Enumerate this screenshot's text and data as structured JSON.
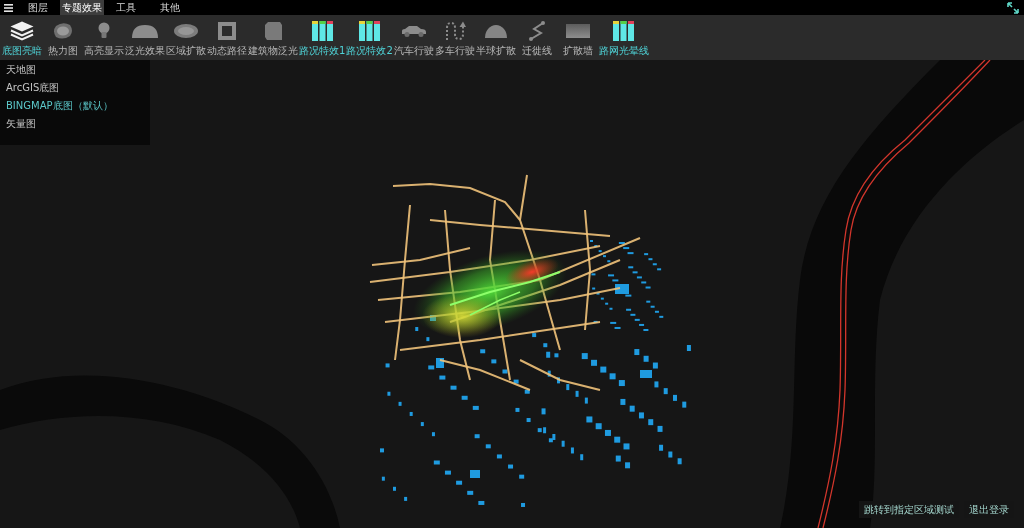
{
  "top_bar": {
    "tabs": [
      {
        "label": "图层",
        "selected": false
      },
      {
        "label": "专题效果",
        "selected": true
      },
      {
        "label": "工具",
        "selected": false
      },
      {
        "label": "其他",
        "selected": false
      }
    ]
  },
  "toolbar": {
    "items": [
      {
        "label": "底图亮暗",
        "kind": "layers",
        "active": true
      },
      {
        "label": "热力图",
        "kind": "blob",
        "active": false
      },
      {
        "label": "高亮显示",
        "kind": "bulb",
        "active": false
      },
      {
        "label": "泛光效果",
        "kind": "dome",
        "active": false
      },
      {
        "label": "区域扩散",
        "kind": "ellipse",
        "active": false
      },
      {
        "label": "动态路径",
        "kind": "frame",
        "active": false
      },
      {
        "label": "建筑物泛光",
        "kind": "cube",
        "active": false
      },
      {
        "label": "路况特效1",
        "kind": "bars",
        "active": true
      },
      {
        "label": "路况特效2",
        "kind": "bars",
        "active": true
      },
      {
        "label": "汽车行驶",
        "kind": "car",
        "active": false
      },
      {
        "label": "多车行驶",
        "kind": "multipath",
        "active": false
      },
      {
        "label": "半球扩散",
        "kind": "hemisphere",
        "active": false
      },
      {
        "label": "迁徙线",
        "kind": "zigzag",
        "active": false
      },
      {
        "label": "扩散墙",
        "kind": "wall",
        "active": false
      },
      {
        "label": "路网光晕线",
        "kind": "bars",
        "active": true
      }
    ]
  },
  "basemap_panel": {
    "items": [
      {
        "label": "天地图",
        "selected": false
      },
      {
        "label": "ArcGIS底图",
        "selected": false
      },
      {
        "label": "BINGMAP底图（默认）",
        "selected": true
      },
      {
        "label": "矢量图",
        "selected": false
      }
    ]
  },
  "map_actions": [
    "跳转到指定区域测试",
    "退出登录"
  ]
}
